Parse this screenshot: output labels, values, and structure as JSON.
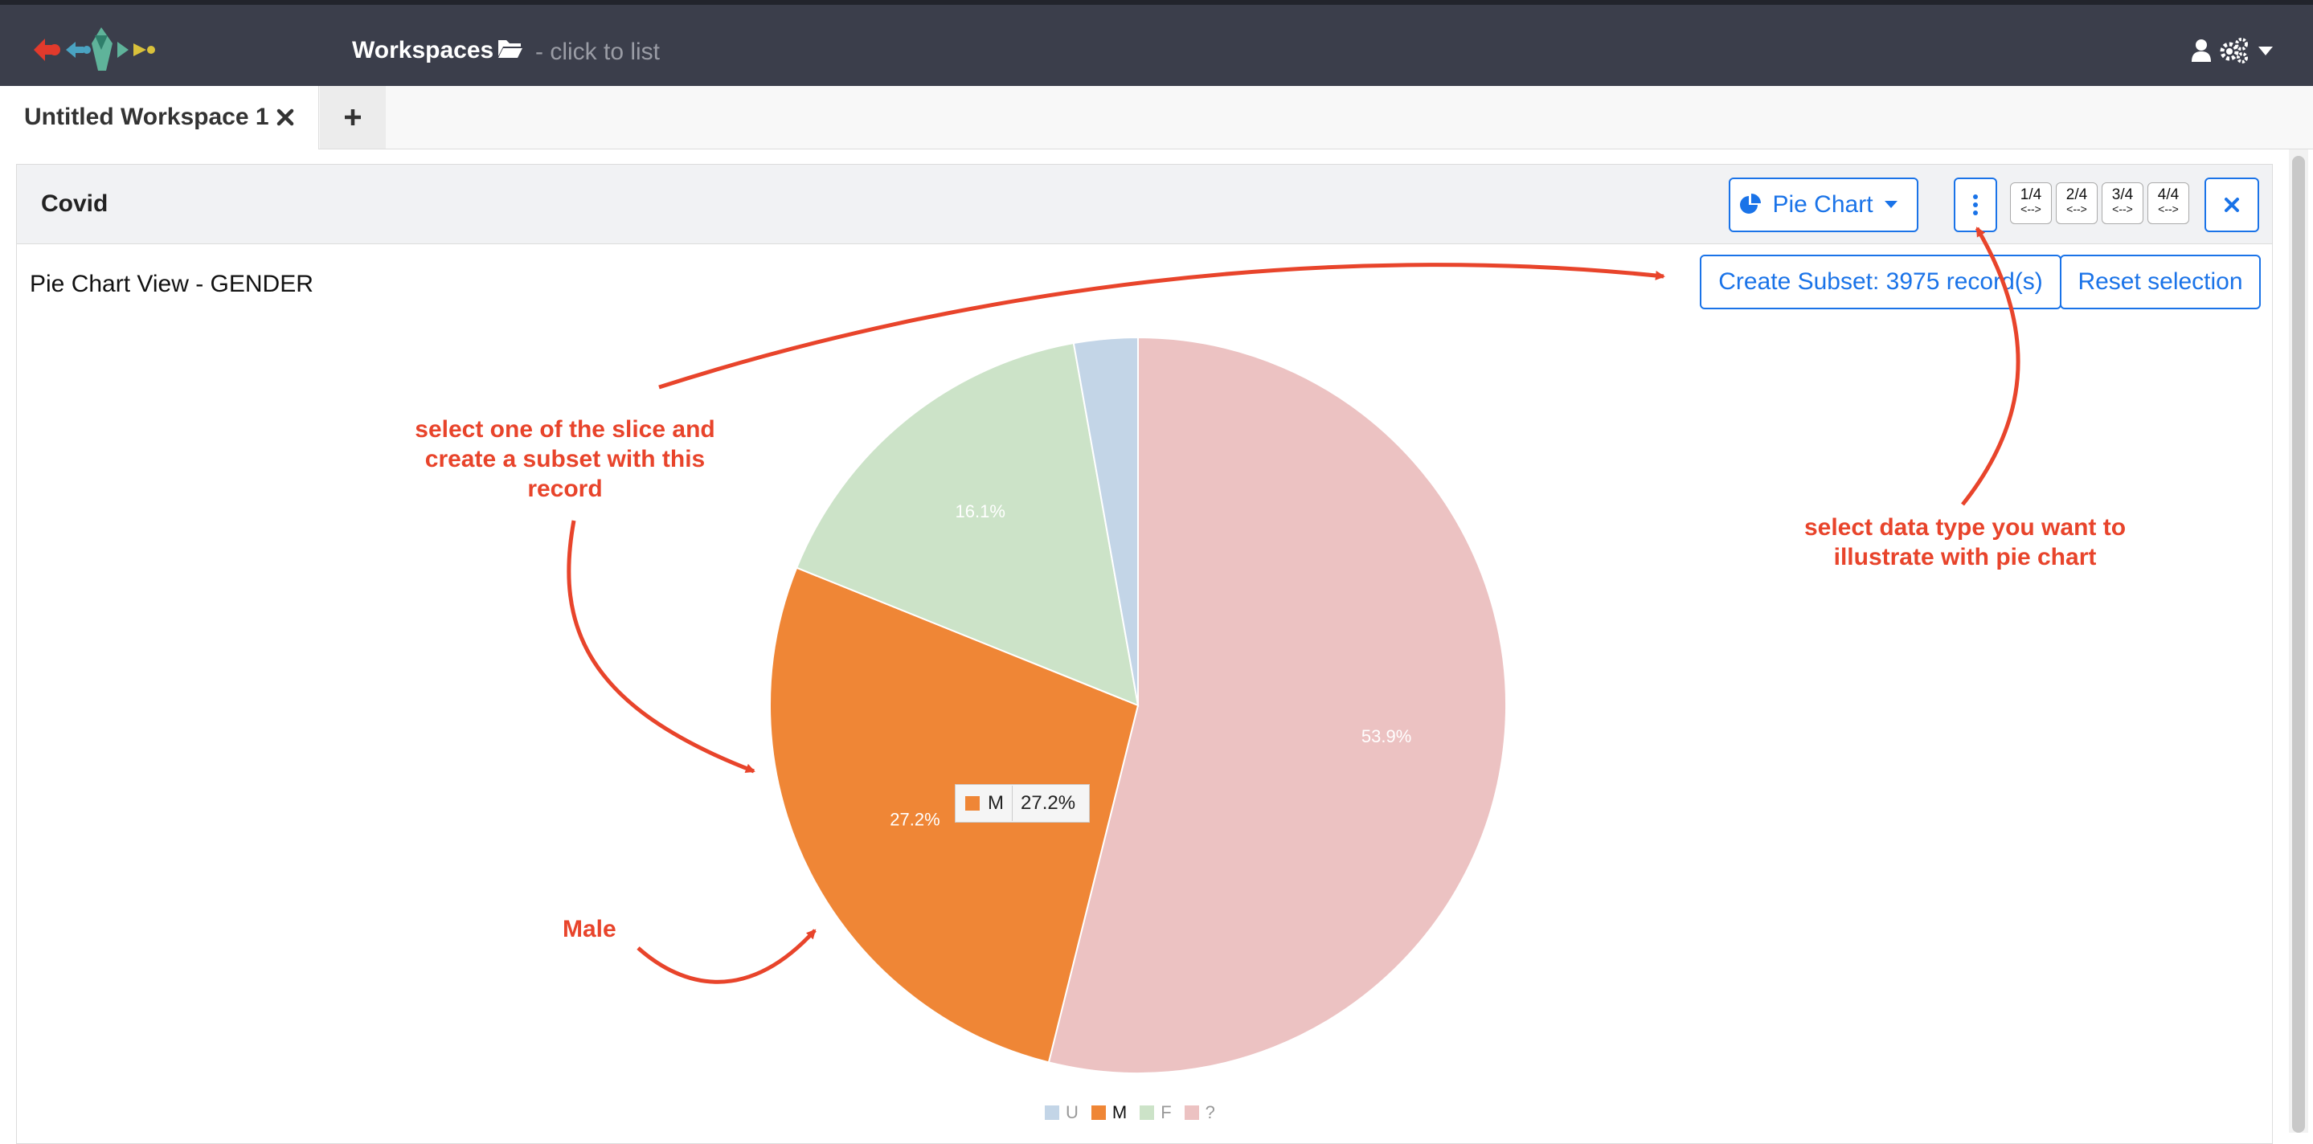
{
  "topbar": {
    "workspaces_label": "Workspaces",
    "workspaces_hint": "- click to list",
    "icons": [
      "app-logo",
      "folder-open-icon",
      "user-icon",
      "gears-icon",
      "caret-down-icon"
    ]
  },
  "tabs": {
    "items": [
      {
        "label": "Untitled Workspace 1",
        "active": true
      }
    ],
    "add_label": "+"
  },
  "panel": {
    "title": "Covid",
    "viz_select_label": "Pie Chart",
    "pages": [
      {
        "top": "1/4",
        "bottom": "<-->"
      },
      {
        "top": "2/4",
        "bottom": "<-->"
      },
      {
        "top": "3/4",
        "bottom": "<-->"
      },
      {
        "top": "4/4",
        "bottom": "<-->"
      }
    ],
    "view_label": "Pie Chart View - GENDER",
    "subset_button": "Create Subset: 3975 record(s)",
    "reset_button": "Reset selection"
  },
  "tooltip": {
    "category": "M",
    "value": "27.2%"
  },
  "annotations": {
    "slice": "select one of the slice and create a subset with this record",
    "data_type": "select data type you want to illustrate with pie chart",
    "male": "Male"
  },
  "colors": {
    "accent": "#1a73e8",
    "annotation": "#e8442b",
    "topbar": "#3b3e4b"
  },
  "chart_data": {
    "type": "pie",
    "title": "",
    "slices": [
      {
        "label": "?",
        "value": 53.9,
        "color": "#ecc2c2",
        "label_text": "53.9%"
      },
      {
        "label": "M",
        "value": 27.2,
        "color": "#ef8636",
        "label_text": "27.2%"
      },
      {
        "label": "F",
        "value": 16.1,
        "color": "#cce3c8",
        "label_text": "16.1%"
      },
      {
        "label": "U",
        "value": 2.8,
        "color": "#c3d5e7",
        "label_text": ""
      }
    ],
    "legend": [
      {
        "label": "U",
        "color": "#c3d5e7",
        "active": false
      },
      {
        "label": "M",
        "color": "#ef8636",
        "active": true
      },
      {
        "label": "F",
        "color": "#cce3c8",
        "active": false
      },
      {
        "label": "?",
        "color": "#ecc2c2",
        "active": false
      }
    ],
    "legend_position": "bottom-center"
  }
}
